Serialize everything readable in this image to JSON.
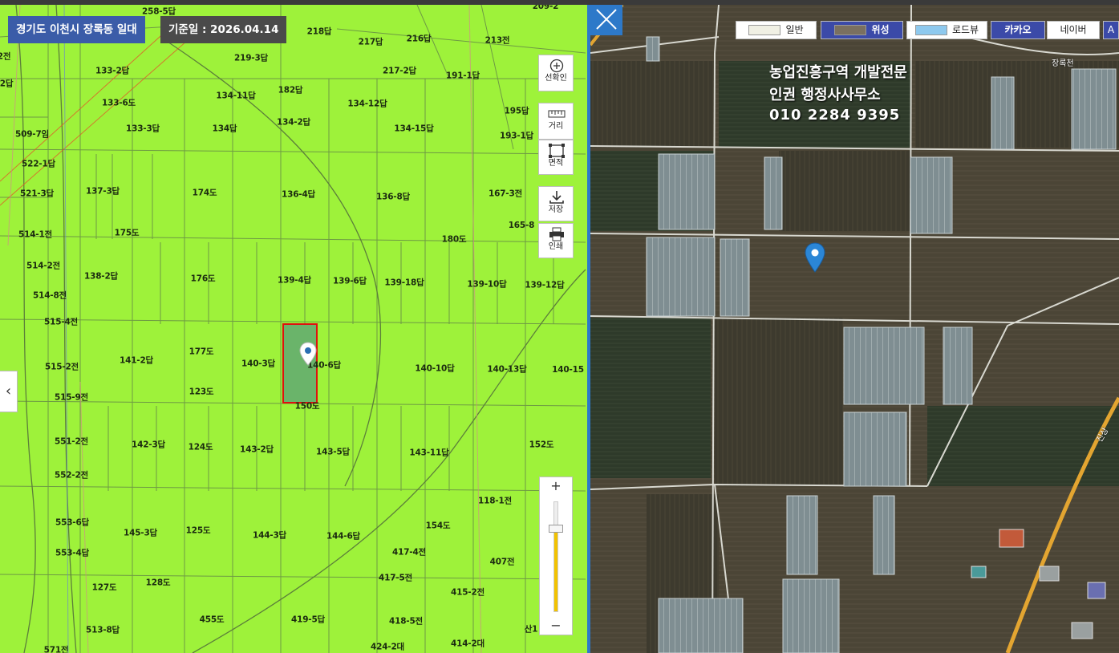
{
  "header": {
    "region": "경기도 이천시 장록동 일대",
    "reference_date": "기준일 : 2026.04.14"
  },
  "tools": [
    {
      "label": "선확인",
      "icon": "plus-circle-icon"
    },
    {
      "label": "거리",
      "icon": "ruler-icon"
    },
    {
      "label": "면적",
      "icon": "area-square-icon"
    },
    {
      "label": "저장",
      "icon": "download-icon"
    },
    {
      "label": "인쇄",
      "icon": "printer-icon"
    }
  ],
  "zoom": {
    "plus": "+",
    "minus": "−",
    "level_fraction": 0.78
  },
  "collapse_glyph": "‹",
  "map_types": {
    "general": "일반",
    "satellite": "위성",
    "roadview": "로드뷰",
    "kakao": "카카오",
    "naver": "네이버",
    "extra": "A"
  },
  "ad_text": [
    "농업진흥구역 개발전문",
    "인권 행정사사무소",
    "010 2284 9395"
  ],
  "satellite_labels": [
    "장록천",
    "진상"
  ],
  "parcels": [
    "258-5답",
    "209-2",
    "218답",
    "217답",
    "216답",
    "213전",
    "2전",
    "219-3답",
    "133-2답",
    "217-2답",
    "191-1답",
    "2답",
    "133-6도",
    "134-11답",
    "182답",
    "134-12답",
    "195답",
    "509-7임",
    "133-3답",
    "134답",
    "134-2답",
    "134-15답",
    "193-1답",
    "522-1답",
    "521-3답",
    "137-3답",
    "174도",
    "136-4답",
    "136-8답",
    "167-3전",
    "165-8",
    "514-1전",
    "175도",
    "180도",
    "514-2전",
    "138-2답",
    "176도",
    "139-4답",
    "139-6답",
    "139-18답",
    "139-10답",
    "139-12답",
    "514-8전",
    "515-4전",
    "177도",
    "515-2전",
    "141-2답",
    "140-3답",
    "140-6답",
    "140-10답",
    "140-13답",
    "140-15",
    "123도",
    "515-9전",
    "150도",
    "551-2전",
    "142-3답",
    "124도",
    "143-2답",
    "143-5답",
    "143-11답",
    "152도",
    "552-2전",
    "118-1전",
    "553-6답",
    "145-3답",
    "125도",
    "144-3답",
    "144-6답",
    "154도",
    "553-4답",
    "417-4전",
    "407전",
    "128도",
    "127도",
    "417-5전",
    "415-2전",
    "513-8답",
    "455도",
    "419-5답",
    "418-5전",
    "산1",
    "571전",
    "424-2대",
    "414-2대"
  ]
}
